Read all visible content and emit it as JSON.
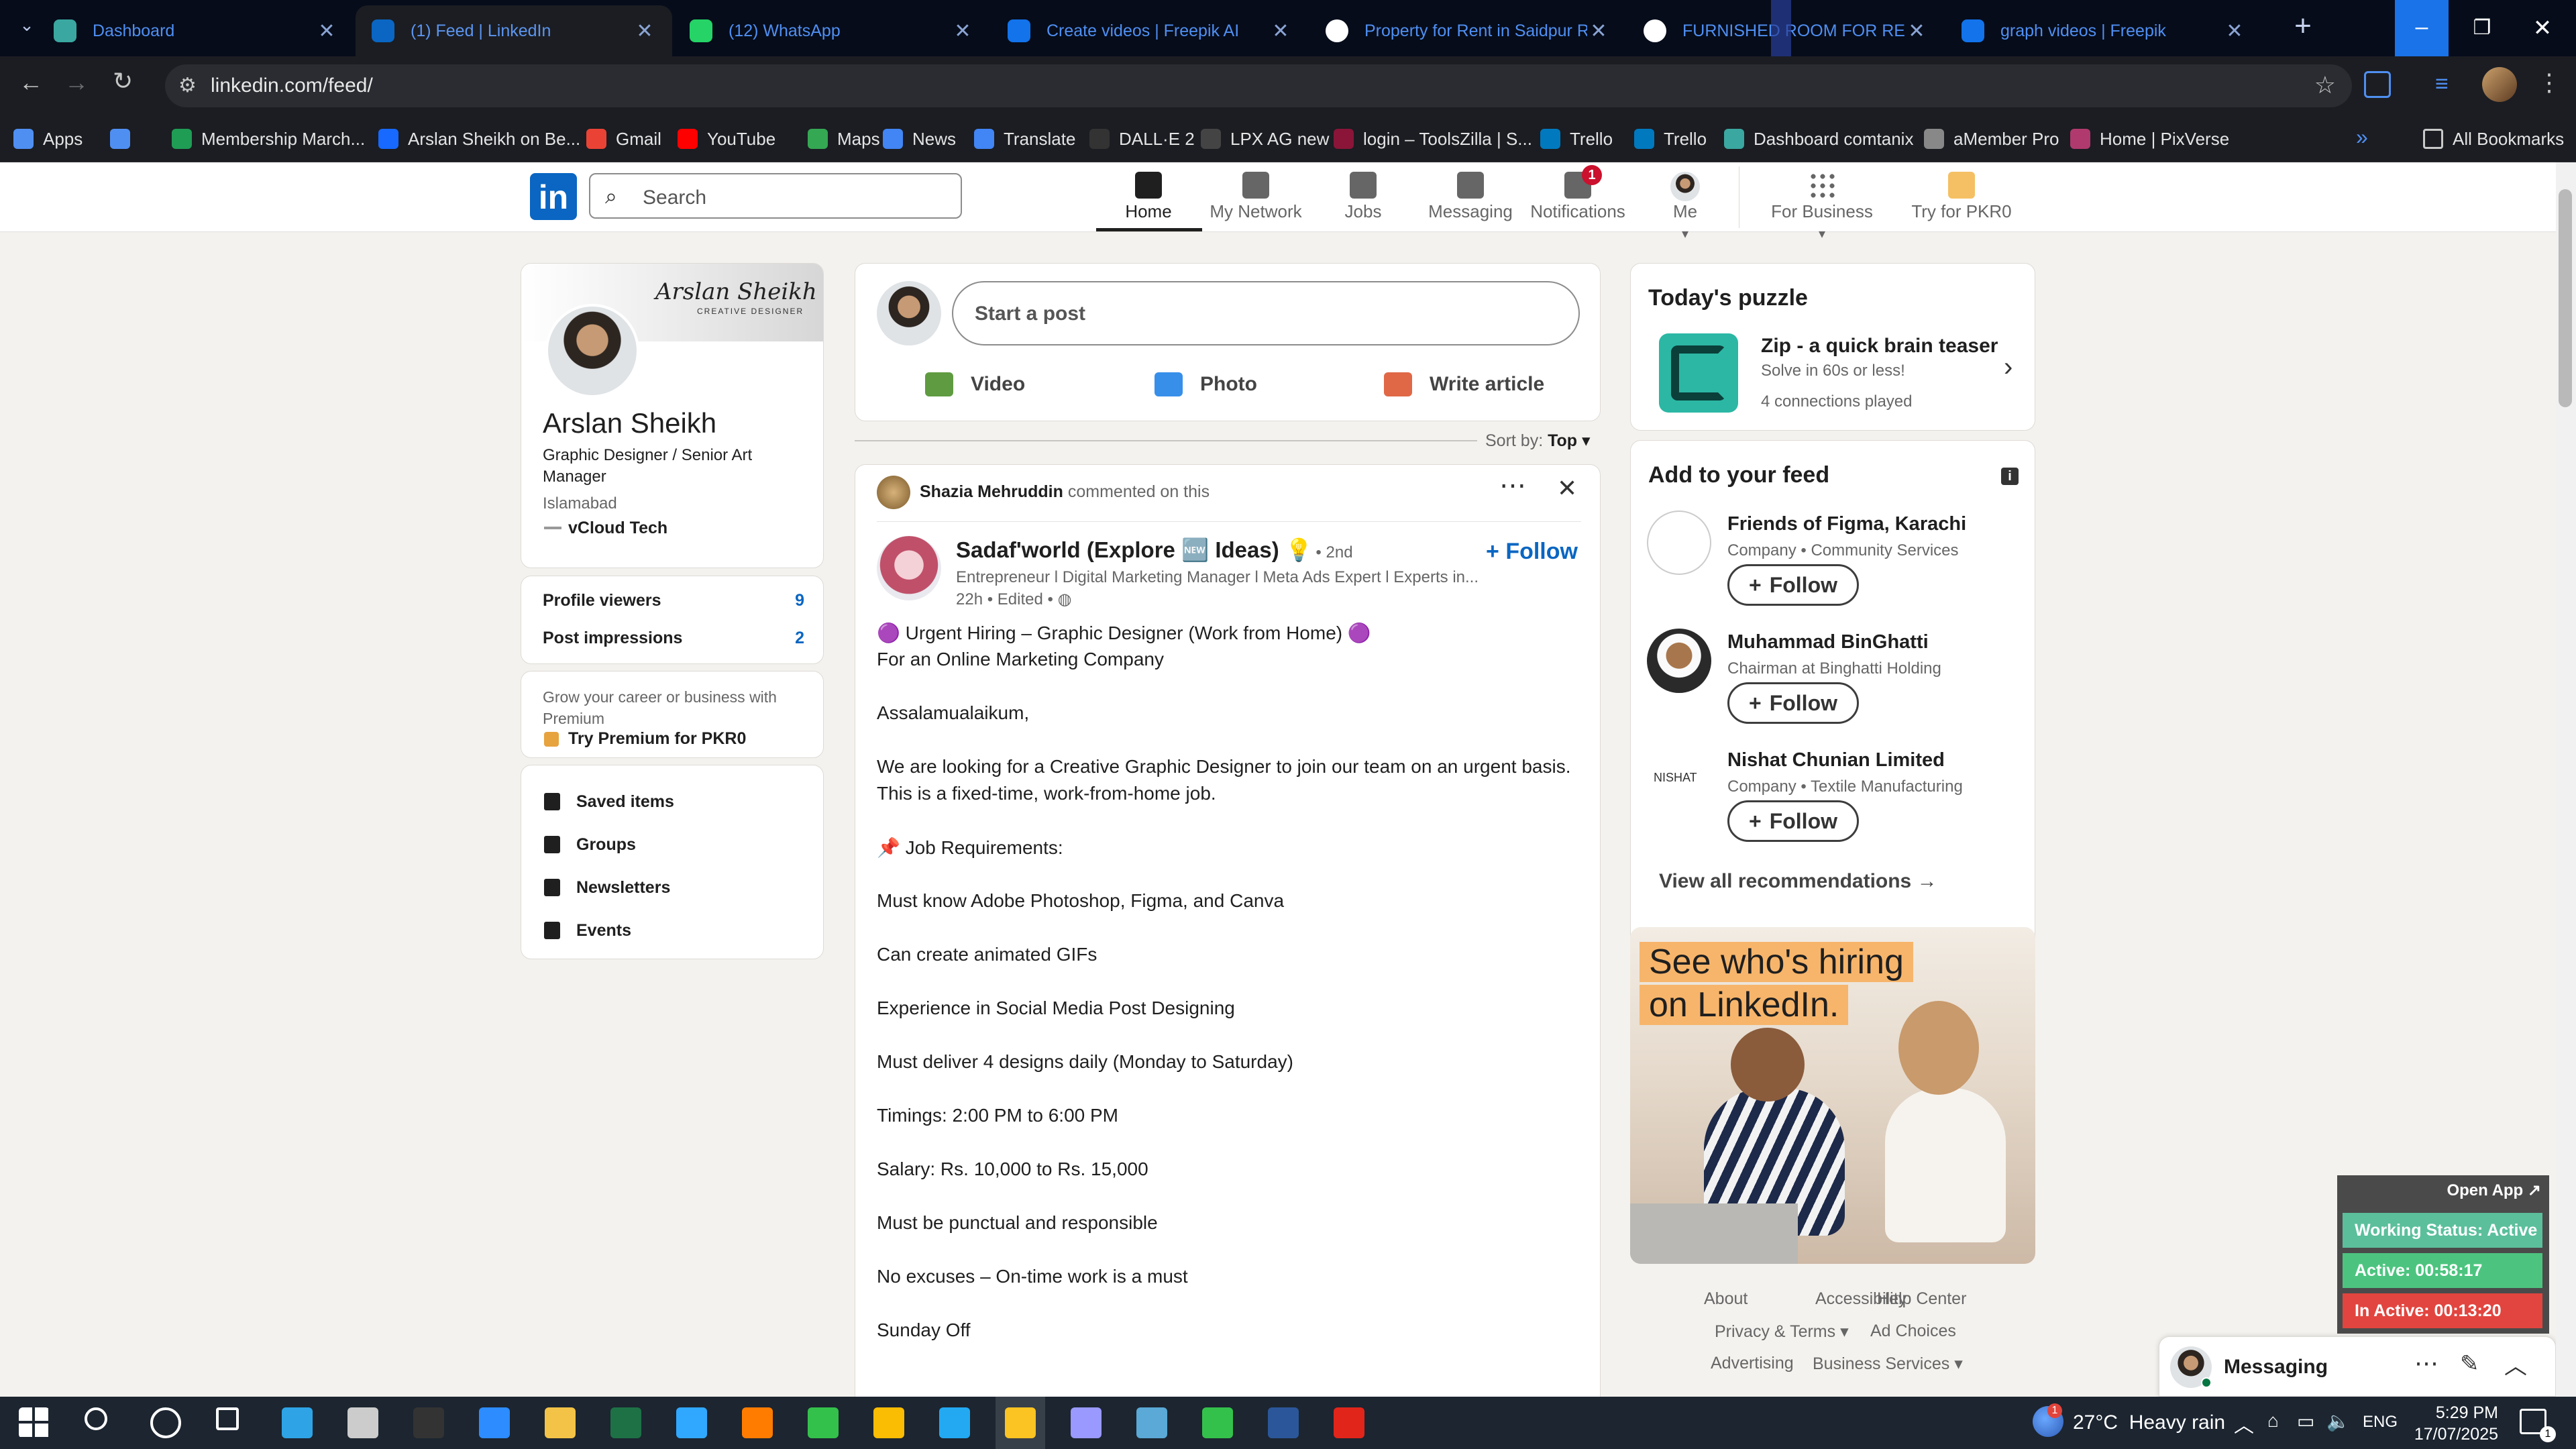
{
  "browser": {
    "tabs": [
      {
        "title": "Dashboard",
        "icon": "dashboard-favicon",
        "color": "#3aa7a0"
      },
      {
        "title": "(1) Feed | LinkedIn",
        "icon": "linkedin-favicon",
        "color": "#0a66c2"
      },
      {
        "title": "(12) WhatsApp",
        "icon": "whatsapp-favicon",
        "color": "#25d366"
      },
      {
        "title": "Create videos | Freepik AI",
        "icon": "freepik-favicon",
        "color": "#1273eb"
      },
      {
        "title": "Property for Rent in Saidpur Ro",
        "icon": "olx-favicon",
        "color": "#ffffff"
      },
      {
        "title": "FURNISHED ROOM FOR RENT",
        "icon": "olx-favicon",
        "color": "#ffffff"
      },
      {
        "title": "graph videos | Freepik",
        "icon": "freepik-favicon",
        "color": "#1273eb"
      }
    ],
    "url": "linkedin.com/feed/",
    "bookmarks": [
      {
        "label": "Apps",
        "icon": "apps-grid-icon"
      },
      {
        "label": "",
        "icon": "tab-groups-icon"
      },
      {
        "label": "Membership March...",
        "icon": "membership-icon"
      },
      {
        "label": "Arslan Sheikh on Be...",
        "icon": "behance-icon"
      },
      {
        "label": "Gmail",
        "icon": "gmail-icon"
      },
      {
        "label": "YouTube",
        "icon": "youtube-icon"
      },
      {
        "label": "Maps",
        "icon": "maps-icon"
      },
      {
        "label": "News",
        "icon": "news-icon"
      },
      {
        "label": "Translate",
        "icon": "translate-icon"
      },
      {
        "label": "DALL·E 2",
        "icon": "dalle-icon"
      },
      {
        "label": "LPX AG new",
        "icon": "lpx-icon"
      },
      {
        "label": "login – ToolsZilla | S...",
        "icon": "toolszilla-icon"
      },
      {
        "label": "Trello",
        "icon": "trello-icon"
      },
      {
        "label": "Trello",
        "icon": "trello-icon"
      },
      {
        "label": "Dashboard comtanix",
        "icon": "dashboard-icon"
      },
      {
        "label": "aMember Pro",
        "icon": "amember-icon"
      },
      {
        "label": "Home | PixVerse",
        "icon": "pixverse-icon"
      }
    ],
    "all_bookmarks": "All Bookmarks"
  },
  "linkedin": {
    "search_placeholder": "Search",
    "nav": [
      {
        "label": "Home",
        "icon": "home-icon"
      },
      {
        "label": "My Network",
        "icon": "network-icon"
      },
      {
        "label": "Jobs",
        "icon": "jobs-icon"
      },
      {
        "label": "Messaging",
        "icon": "messaging-icon"
      },
      {
        "label": "Notifications",
        "icon": "bell-icon",
        "badge": "1"
      },
      {
        "label": "Me",
        "icon": "avatar"
      },
      {
        "label": "For Business",
        "icon": "grid-icon"
      },
      {
        "label": "Try for PKR0",
        "icon": "premium-icon"
      }
    ],
    "profile": {
      "banner_name": "Arslan Sheikh",
      "banner_sub": "CREATIVE DESIGNER",
      "name": "Arslan Sheikh",
      "headline": "Graphic Designer / Senior Art Manager",
      "location": "Islamabad",
      "company": "vCloud Tech",
      "stats": [
        {
          "label": "Profile viewers",
          "value": "9"
        },
        {
          "label": "Post impressions",
          "value": "2"
        }
      ],
      "premium_text": "Grow your career or business with Premium",
      "premium_link": "Try Premium for PKR0",
      "links": [
        {
          "label": "Saved items",
          "icon": "bookmark-icon"
        },
        {
          "label": "Groups",
          "icon": "groups-icon"
        },
        {
          "label": "Newsletters",
          "icon": "newsletter-icon"
        },
        {
          "label": "Events",
          "icon": "calendar-icon"
        }
      ]
    },
    "composer": {
      "placeholder": "Start a post",
      "actions": [
        {
          "label": "Video",
          "icon": "video-icon",
          "color": "#5f9b41"
        },
        {
          "label": "Photo",
          "icon": "photo-icon",
          "color": "#378fe9"
        },
        {
          "label": "Write article",
          "icon": "article-icon",
          "color": "#e06847"
        }
      ]
    },
    "sort": {
      "label": "Sort by:",
      "value": "Top"
    },
    "post": {
      "context_name": "Shazia Mehruddin",
      "context_text": "commented on this",
      "author": "Sadaf'world (Explore 🆕 Ideas) 💡",
      "degree": "• 2nd",
      "subtitle": "Entrepreneur l Digital Marketing Manager l Meta Ads Expert l Experts in...",
      "meta": "22h • Edited •",
      "follow": "Follow",
      "lines": [
        "🟣 Urgent Hiring – Graphic Designer (Work from Home) 🟣",
        "For an Online Marketing Company",
        "",
        "Assalamualaikum,",
        "",
        "We are looking for a Creative Graphic Designer to join our team on an urgent basis.",
        "This is a fixed-time, work-from-home job.",
        "",
        "📌 Job Requirements:",
        "",
        "Must know Adobe Photoshop, Figma, and Canva",
        "",
        "Can create animated GIFs",
        "",
        "Experience in Social Media Post Designing",
        "",
        "Must deliver 4 designs daily (Monday to Saturday)",
        "",
        "Timings: 2:00 PM to 6:00 PM",
        "",
        "Salary: Rs. 10,000 to Rs. 15,000",
        "",
        "Must be punctual and responsible",
        "",
        "No excuses – On-time work is a must",
        "",
        "Sunday Off"
      ]
    },
    "puzzle": {
      "heading": "Today's puzzle",
      "title": "Zip - a quick brain teaser",
      "sub": "Solve in 60s or less!",
      "played": "4 connections played"
    },
    "add_feed": {
      "heading": "Add to your feed",
      "items": [
        {
          "name": "Friends of Figma, Karachi",
          "desc": "Company • Community Services",
          "follow": "Follow"
        },
        {
          "name": "Muhammad BinGhatti",
          "desc": "Chairman at Binghatti Holding",
          "follow": "Follow"
        },
        {
          "name": "Nishat Chunian Limited",
          "desc": "Company • Textile Manufacturing",
          "follow": "Follow",
          "logo_text": "NISHAT"
        }
      ],
      "view_all": "View all recommendations →"
    },
    "ad": {
      "line1": "See who's hiring",
      "line2": "on LinkedIn."
    },
    "footer": [
      "About",
      "Accessibility",
      "Help Center",
      "Privacy & Terms ▾",
      "Ad Choices",
      "Advertising",
      "Business Services ▾"
    ],
    "messaging": "Messaging"
  },
  "widget": {
    "open_app": "Open App ↗",
    "status": "Working Status: Active",
    "active": "Active: 00:58:17",
    "inactive": "In Active: 00:13:20",
    "colors": {
      "status": "#5bbf9c",
      "active": "#4cc47f",
      "inactive": "#e2453f"
    }
  },
  "taskbar": {
    "weather": "27°C  Heavy rain",
    "lang": "ENG",
    "time": "5:29 PM",
    "date": "17/07/2025",
    "notif_badge": "1"
  }
}
